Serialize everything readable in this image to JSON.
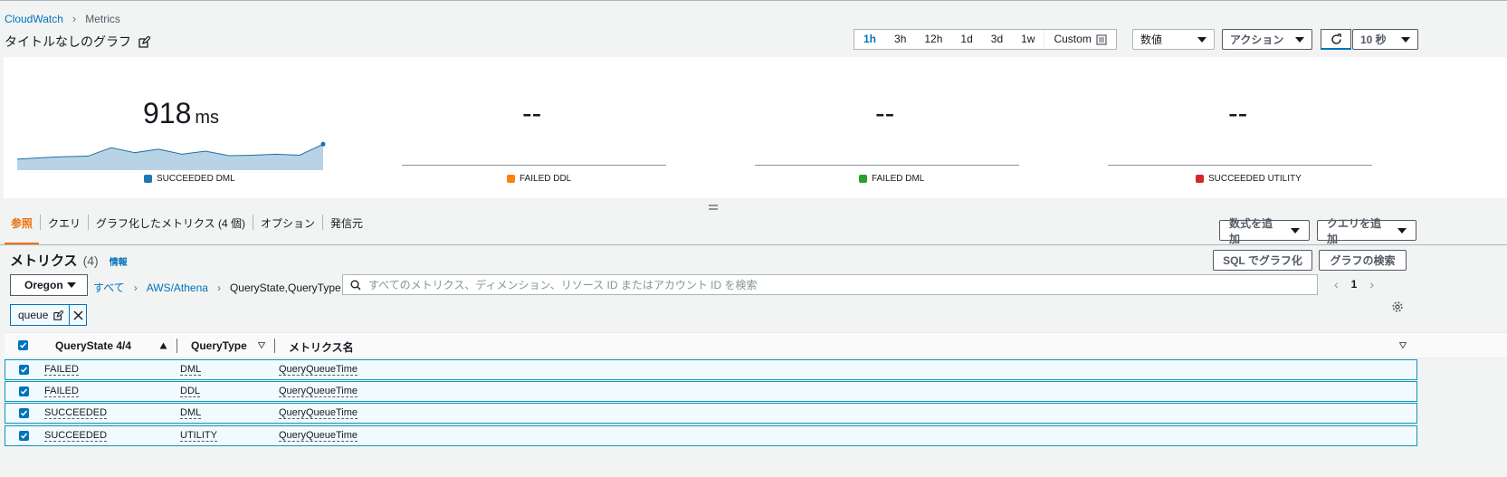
{
  "breadcrumb": {
    "root": "CloudWatch",
    "current": "Metrics"
  },
  "graph_title": "タイトルなしのグラフ",
  "time_ranges": [
    "1h",
    "3h",
    "12h",
    "1d",
    "3d",
    "1w"
  ],
  "time_active": "1h",
  "custom_label": "Custom",
  "view_select": "数値",
  "actions_label": "アクション",
  "refresh_interval": "10 秒",
  "widgets": [
    {
      "value": "918",
      "unit": "ms",
      "legend": "SUCCEEDED DML",
      "color": "#1f77b4"
    },
    {
      "value": "--",
      "unit": "",
      "legend": "FAILED DDL",
      "color": "#ff7f0e"
    },
    {
      "value": "--",
      "unit": "",
      "legend": "FAILED DML",
      "color": "#2ca02c"
    },
    {
      "value": "--",
      "unit": "",
      "legend": "SUCCEEDED UTILITY",
      "color": "#d62728"
    }
  ],
  "sparkline": [
    0.22,
    0.25,
    0.27,
    0.28,
    0.45,
    0.35,
    0.42,
    0.32,
    0.38,
    0.29,
    0.3,
    0.32,
    0.3,
    0.52
  ],
  "tabs": [
    "参照",
    "クエリ",
    "グラフ化したメトリクス (4 個)",
    "オプション",
    "発信元"
  ],
  "add_math_label": "数式を追加",
  "add_query_label": "クエリを追加",
  "metrics_title": "メトリクス",
  "metrics_count": "(4)",
  "info_label": "情報",
  "sql_graph_label": "SQL でグラフ化",
  "graph_search_label": "グラフの検索",
  "region": "Oregon",
  "path": {
    "all": "すべて",
    "namespace": "AWS/Athena",
    "dimension": "QueryState,QueryType"
  },
  "search_placeholder": "すべてのメトリクス、ディメンション、リソース ID またはアカウント ID を検索",
  "page": "1",
  "filter_token": "queue",
  "columns": {
    "state": "QueryState 4/4",
    "type": "QueryType",
    "name": "メトリクス名"
  },
  "rows": [
    {
      "state": "FAILED",
      "type": "DML",
      "name": "QueryQueueTime"
    },
    {
      "state": "FAILED",
      "type": "DDL",
      "name": "QueryQueueTime"
    },
    {
      "state": "SUCCEEDED",
      "type": "DML",
      "name": "QueryQueueTime"
    },
    {
      "state": "SUCCEEDED",
      "type": "UTILITY",
      "name": "QueryQueueTime"
    }
  ]
}
